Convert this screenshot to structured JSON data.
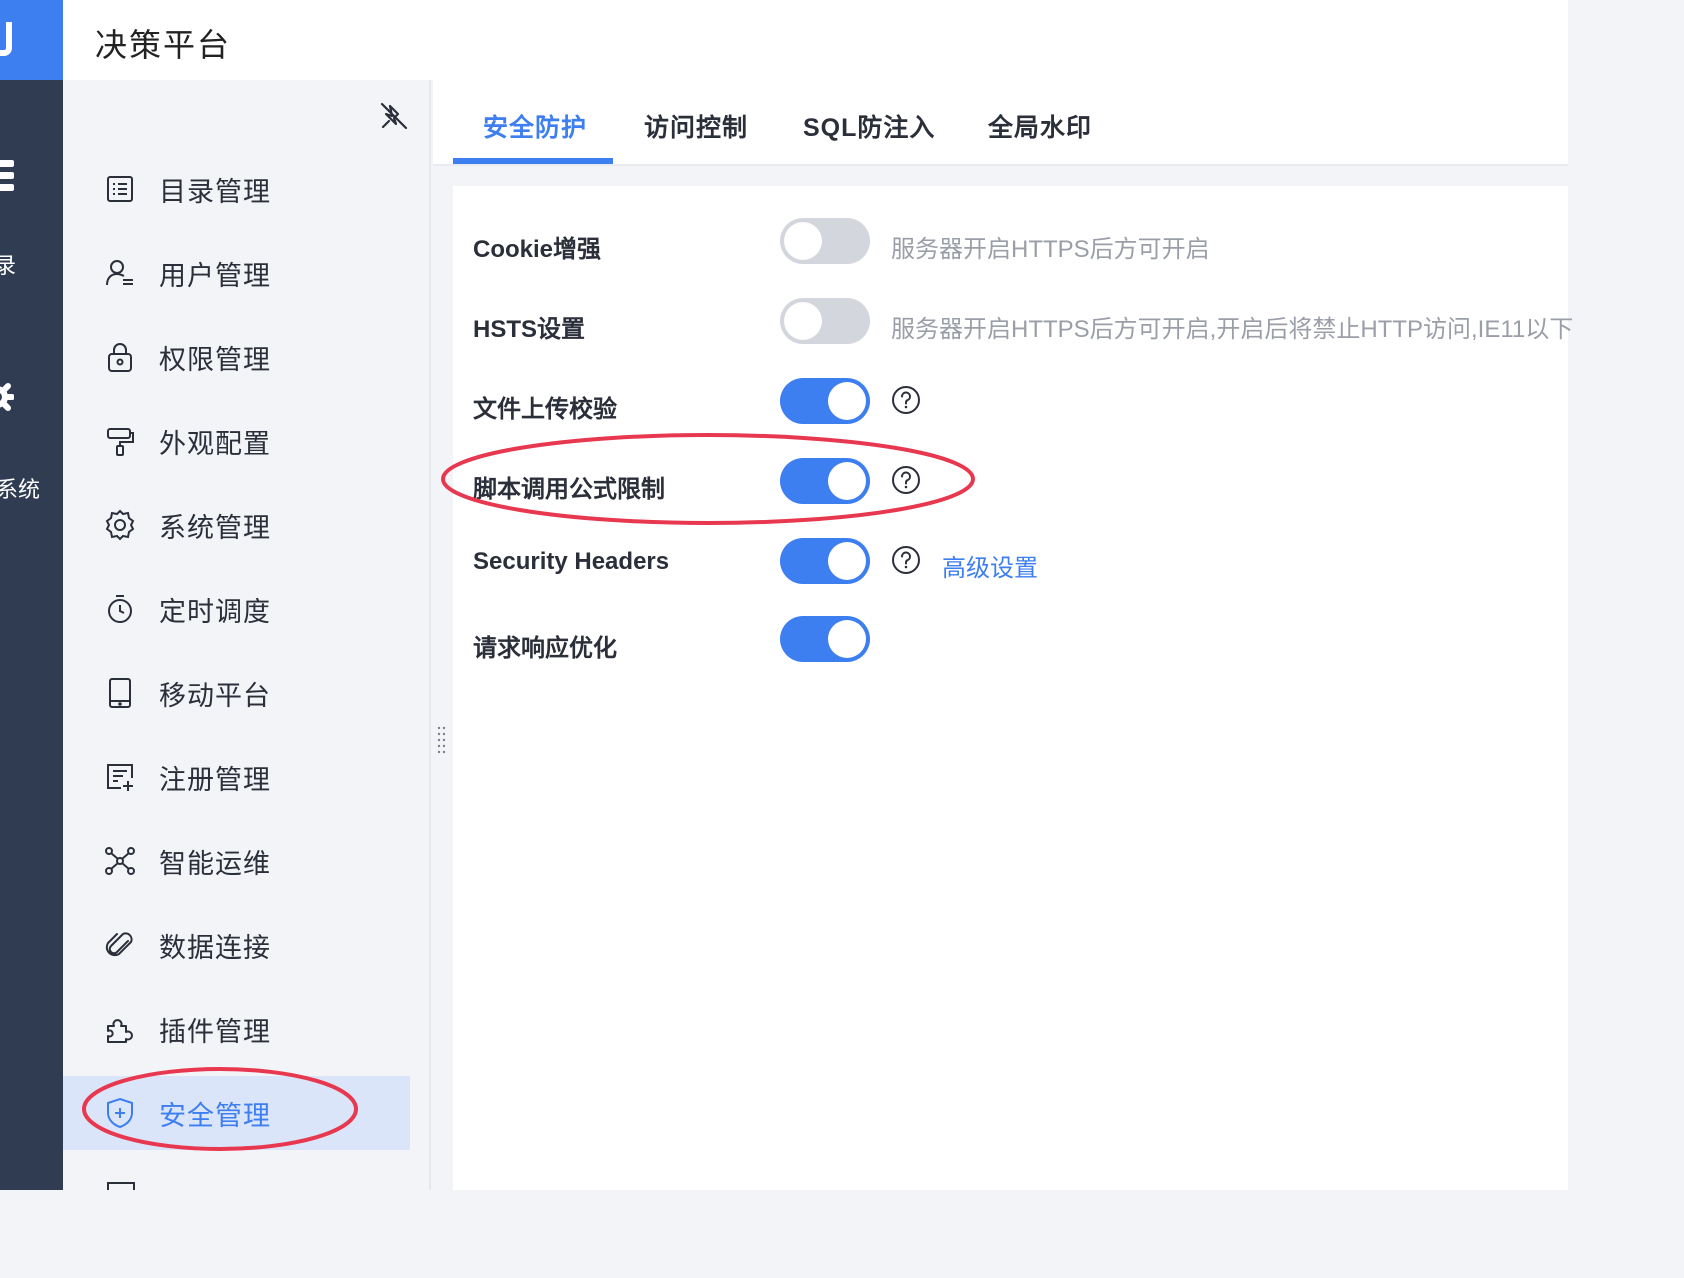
{
  "app": {
    "title": "决策平台"
  },
  "rail": {
    "items": [
      "录",
      "系统"
    ]
  },
  "sidebar": {
    "items": [
      {
        "label": "目录管理",
        "icon": "list-icon"
      },
      {
        "label": "用户管理",
        "icon": "user-icon"
      },
      {
        "label": "权限管理",
        "icon": "lock-icon"
      },
      {
        "label": "外观配置",
        "icon": "paint-roller-icon"
      },
      {
        "label": "系统管理",
        "icon": "gear-icon"
      },
      {
        "label": "定时调度",
        "icon": "stopwatch-icon"
      },
      {
        "label": "移动平台",
        "icon": "tablet-icon"
      },
      {
        "label": "注册管理",
        "icon": "register-icon"
      },
      {
        "label": "智能运维",
        "icon": "network-icon"
      },
      {
        "label": "数据连接",
        "icon": "paperclip-icon"
      },
      {
        "label": "插件管理",
        "icon": "puzzle-icon"
      },
      {
        "label": "安全管理",
        "icon": "shield-icon",
        "active": true
      }
    ]
  },
  "tabs": [
    "安全防护",
    "访问控制",
    "SQL防注入",
    "全局水印"
  ],
  "active_tab": "安全防护",
  "settings": [
    {
      "label": "Cookie增强",
      "enabled": false,
      "hint": "服务器开启HTTPS后方可开启"
    },
    {
      "label": "HSTS设置",
      "enabled": false,
      "hint": "服务器开启HTTPS后方可开启,开启后将禁止HTTP访问,IE11以下"
    },
    {
      "label": "文件上传校验",
      "enabled": true,
      "help": true
    },
    {
      "label": "脚本调用公式限制",
      "enabled": true,
      "help": true
    },
    {
      "label": "Security Headers",
      "enabled": true,
      "help": true,
      "link": "高级设置"
    },
    {
      "label": "请求响应优化",
      "enabled": true
    }
  ],
  "colors": {
    "accent": "#3d7ef0",
    "rail": "#2f3c52",
    "annotation": "#e8384f"
  }
}
